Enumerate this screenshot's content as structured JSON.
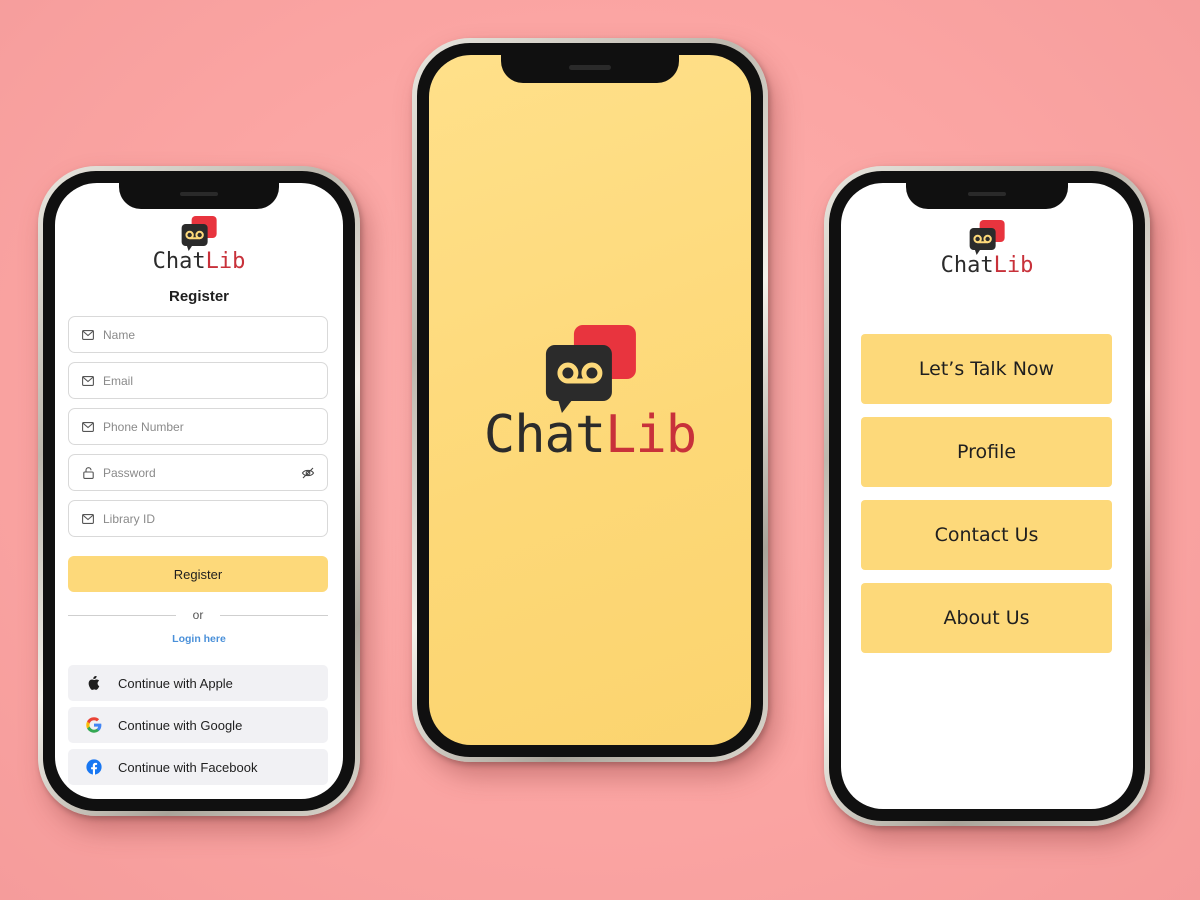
{
  "app": {
    "brand_part1": "Chat",
    "brand_part2": "Lib",
    "colors": {
      "background": "#fba5a3",
      "accent_yellow": "#fdd97a",
      "brand_red": "#e8343e",
      "brand_dark": "#2b2b2b",
      "link_blue": "#4a90d9"
    }
  },
  "register_screen": {
    "title": "Register",
    "fields": [
      {
        "placeholder": "Name",
        "icon": "mail-icon"
      },
      {
        "placeholder": "Email",
        "icon": "mail-icon"
      },
      {
        "placeholder": "Phone Number",
        "icon": "mail-icon"
      },
      {
        "placeholder": "Password",
        "icon": "lock-icon",
        "trailing_icon": "eye-off-icon"
      },
      {
        "placeholder": "Library ID",
        "icon": "mail-icon"
      }
    ],
    "register_button": "Register",
    "divider_text": "or",
    "login_link": "Login here",
    "social_buttons": [
      {
        "label": "Continue with Apple",
        "icon": "apple-icon"
      },
      {
        "label": "Continue with Google",
        "icon": "google-icon"
      },
      {
        "label": "Continue with Facebook",
        "icon": "facebook-icon"
      }
    ]
  },
  "splash_screen": {
    "logo": "chatlib-logo"
  },
  "menu_screen": {
    "buttons": [
      {
        "label": "Let’s Talk Now"
      },
      {
        "label": "Profile"
      },
      {
        "label": "Contact Us"
      },
      {
        "label": "About Us"
      }
    ]
  }
}
